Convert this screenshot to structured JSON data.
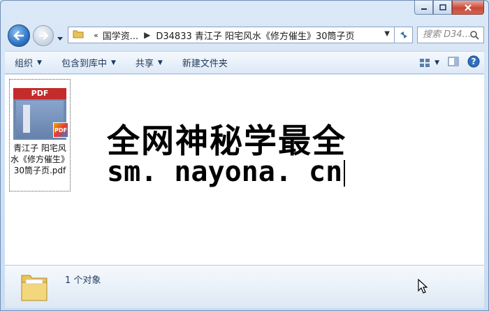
{
  "window": {
    "caption": {
      "minimize_icon": "minimize-icon",
      "maximize_icon": "maximize-icon",
      "close_icon": "close-icon"
    }
  },
  "nav": {
    "address": {
      "overflow": "«",
      "crumb1": "国学资...",
      "crumb_sep": "▶",
      "crumb2": "D34833 青江子 阳宅风水《修方催生》30筒子页"
    },
    "search_placeholder": "搜索 D34..."
  },
  "toolbar": {
    "organize": "组织",
    "include_library": "包含到库中",
    "share": "共享",
    "new_folder": "新建文件夹"
  },
  "file": {
    "thumb_label": "PDF",
    "badge": "PDF",
    "name": "青江子 阳宅风水《修方催生》30筒子页.pdf"
  },
  "watermark": {
    "line1": "全网神秘学最全",
    "line2": "sm. nayona. cn"
  },
  "details": {
    "count_text": "1 个对象"
  },
  "colors": {
    "accent": "#1e395b",
    "window_frame": "#c9dcf1",
    "close_button": "#c9493a"
  }
}
